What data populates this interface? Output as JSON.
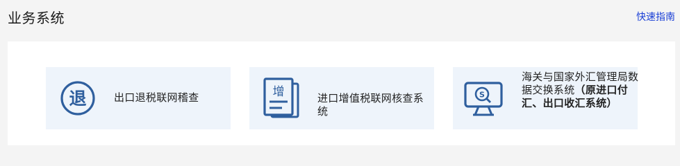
{
  "header": {
    "title": "业务系统",
    "guide_link": "快速指南"
  },
  "cards": [
    {
      "icon": "retreat-circle-icon",
      "icon_text": "退",
      "label": "出口退税联网稽查"
    },
    {
      "icon": "document-stack-icon",
      "icon_text": "增",
      "label": "进口增值税联网核查系统"
    },
    {
      "icon": "monitor-search-icon",
      "icon_text": "S",
      "label_main": "海关与国家外汇管理局数据交换系统",
      "label_bold": "（原进口付汇、出口收汇系统）"
    }
  ],
  "colors": {
    "icon_blue": "#2f5f9e",
    "card_bg": "#eef4fb",
    "link": "#1a3fd6"
  }
}
